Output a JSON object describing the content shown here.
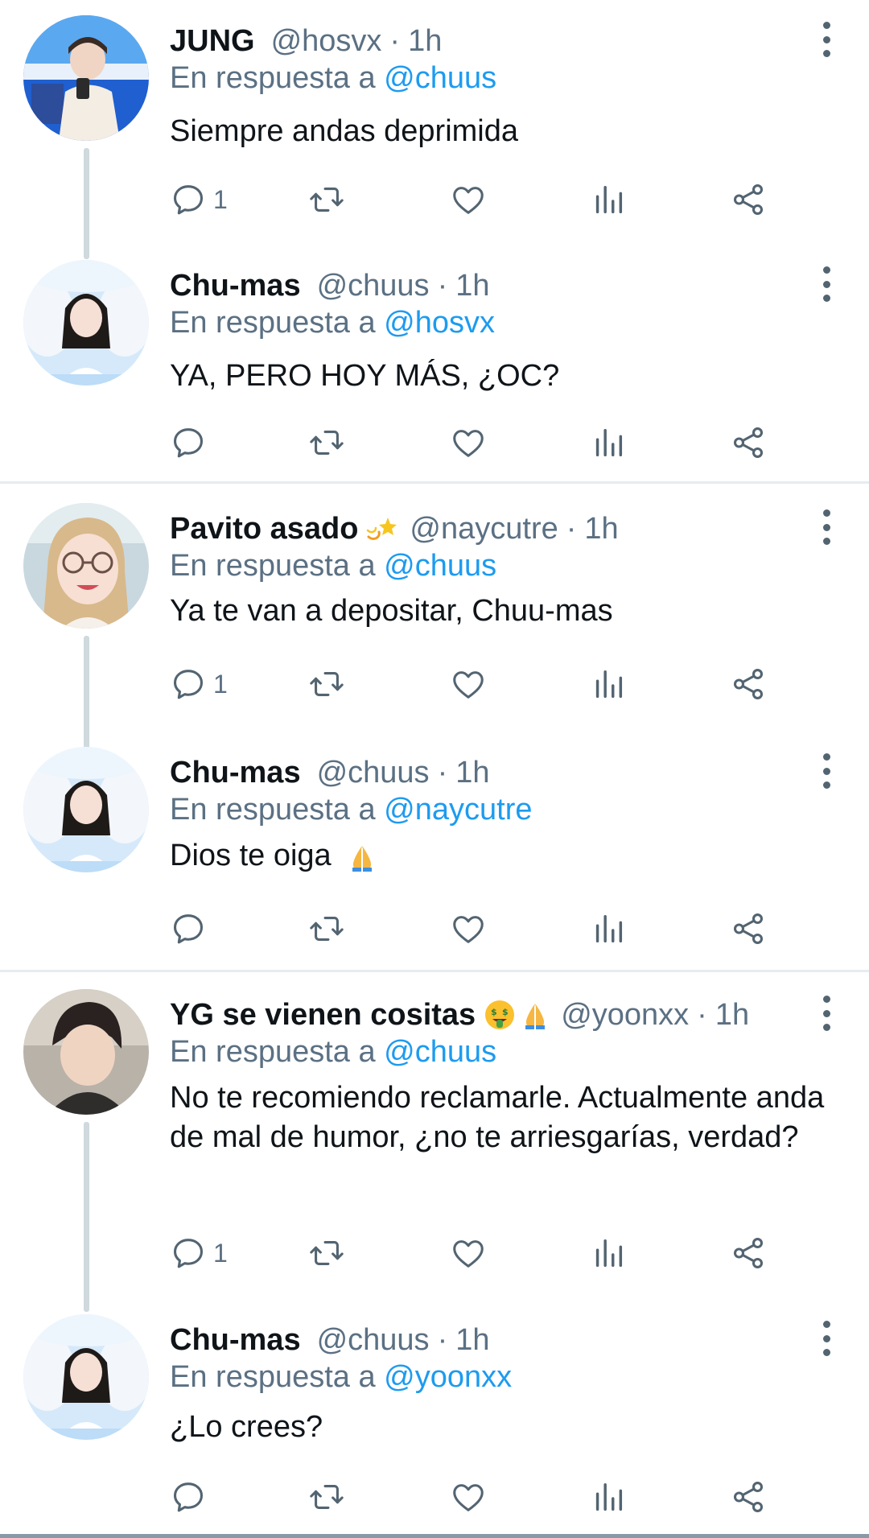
{
  "colors": {
    "mention": "#1d9bf0",
    "secondary_text": "#5b7083",
    "icon": "#536471",
    "divider": "#e6ecf0"
  },
  "tweets": [
    {
      "name": "JUNG",
      "handle": "@hosvx",
      "dot": "·",
      "time": "1h",
      "reply_prefix": "En respuesta a",
      "reply_to": "@chuus",
      "text": "Siempre andas deprimida",
      "reply_count": "1",
      "avatar_icon": "avatar-photo-jung"
    },
    {
      "name": "Chu-mas",
      "handle": "@chuus",
      "dot": "·",
      "time": "1h",
      "reply_prefix": "En respuesta a",
      "reply_to": "@hosvx",
      "text": "YA, PERO HOY MÁS, ¿OC?",
      "reply_count": "",
      "avatar_icon": "avatar-photo-chumas"
    },
    {
      "name": "Pavito asado",
      "name_emoji": "dizzy-star-emoji",
      "handle": "@naycutre",
      "dot": "·",
      "time": "1h",
      "reply_prefix": "En respuesta a",
      "reply_to": "@chuus",
      "text": "Ya te van a depositar, Chuu-mas",
      "reply_count": "1",
      "avatar_icon": "avatar-photo-pavito"
    },
    {
      "name": "Chu-mas",
      "handle": "@chuus",
      "dot": "·",
      "time": "1h",
      "reply_prefix": "En respuesta a",
      "reply_to": "@naycutre",
      "text": "Dios te oiga",
      "text_emoji": "folded-hands-emoji",
      "reply_count": "",
      "avatar_icon": "avatar-photo-chumas"
    },
    {
      "name": "YG se vienen cositas",
      "name_emoji": "money-mouth-emoji",
      "name_emoji2": "folded-hands-emoji",
      "handle": "@yoonxx",
      "dot": "·",
      "time": "1h",
      "reply_prefix": "En respuesta a",
      "reply_to": "@chuus",
      "text": "No te recomiendo reclamarle. Actualmente anda de mal de humor, ¿no te arriesgarías, verdad?",
      "reply_count": "1",
      "avatar_icon": "avatar-photo-yg"
    },
    {
      "name": "Chu-mas",
      "handle": "@chuus",
      "dot": "·",
      "time": "1h",
      "reply_prefix": "En respuesta a",
      "reply_to": "@yoonxx",
      "text": "¿Lo crees?",
      "reply_count": "",
      "avatar_icon": "avatar-photo-chumas"
    }
  ]
}
